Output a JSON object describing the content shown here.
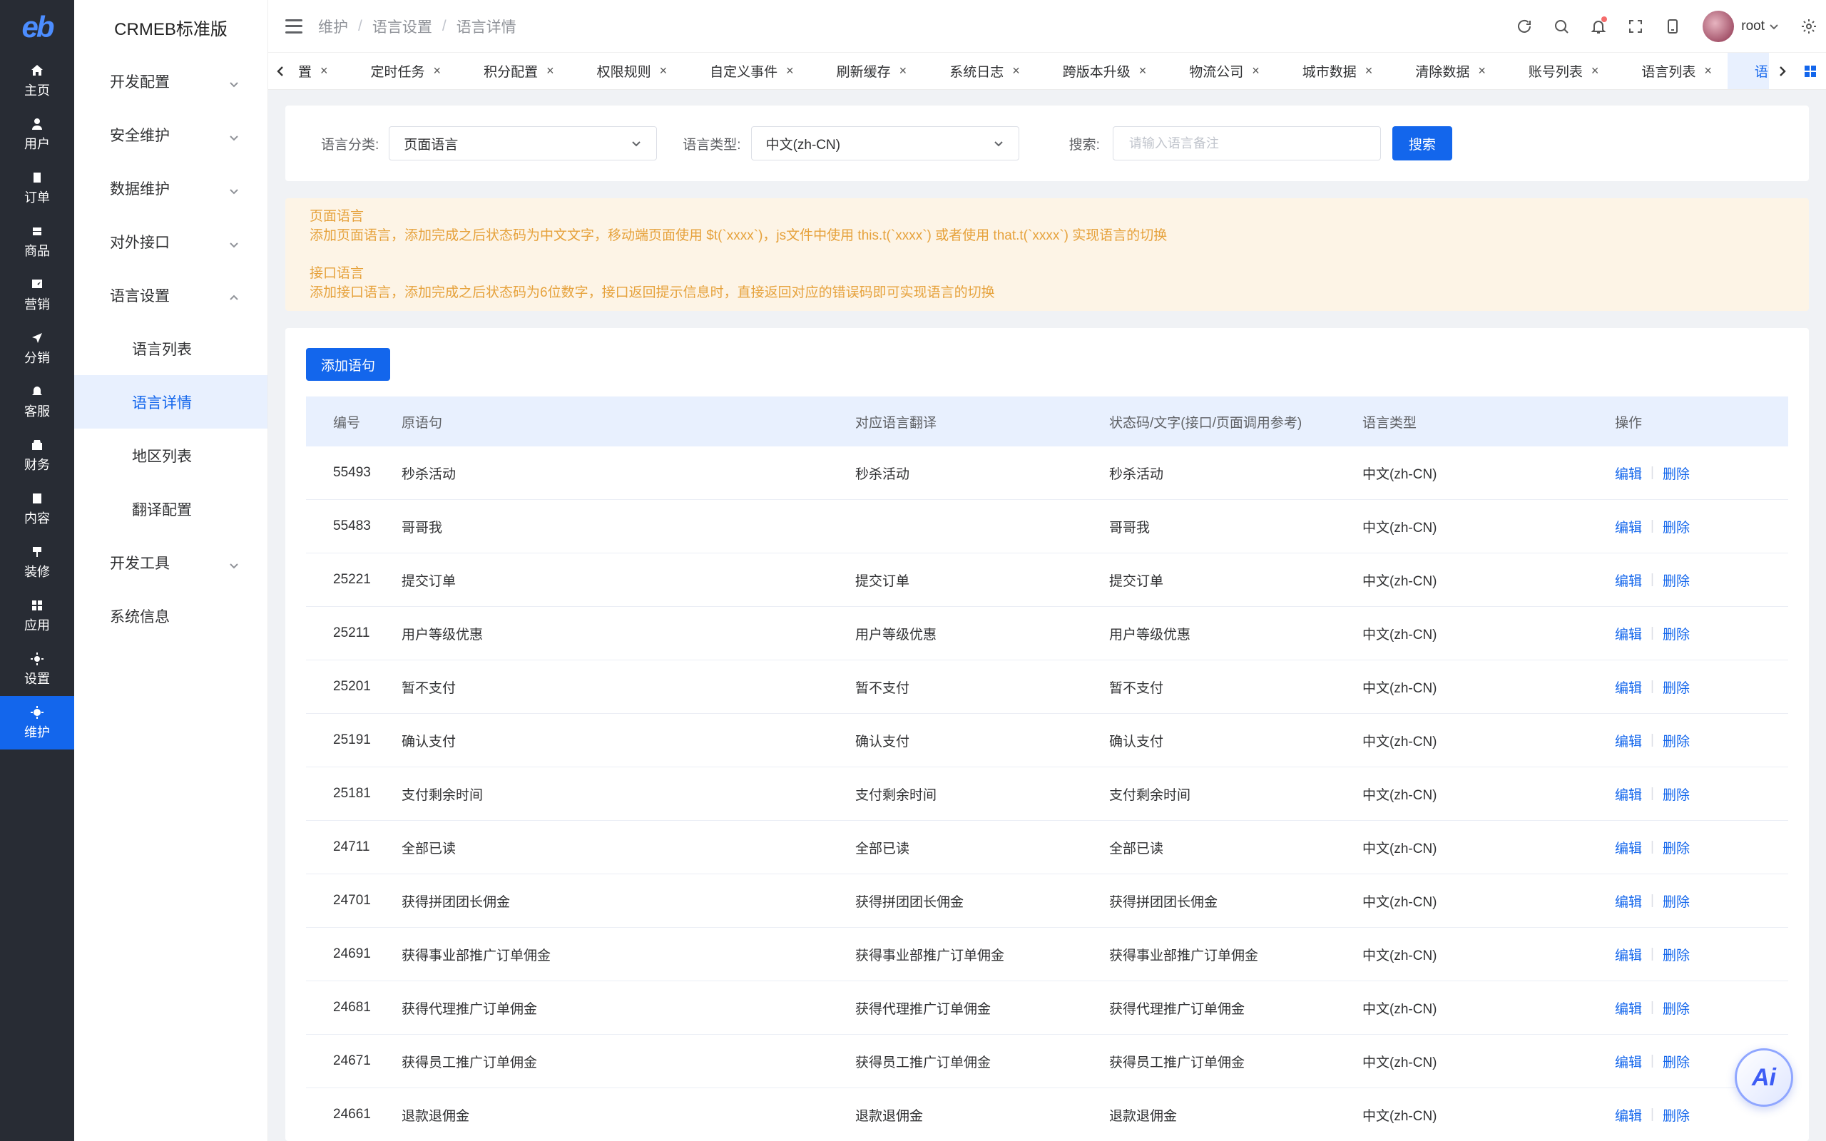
{
  "logo": "eb",
  "brand": "CRMEB标准版",
  "rail": [
    {
      "label": "主页",
      "icon": "home-icon"
    },
    {
      "label": "用户",
      "icon": "user-icon"
    },
    {
      "label": "订单",
      "icon": "order-icon"
    },
    {
      "label": "商品",
      "icon": "product-icon"
    },
    {
      "label": "营销",
      "icon": "marketing-icon"
    },
    {
      "label": "分销",
      "icon": "distribution-icon"
    },
    {
      "label": "客服",
      "icon": "service-icon"
    },
    {
      "label": "财务",
      "icon": "finance-icon"
    },
    {
      "label": "内容",
      "icon": "content-icon"
    },
    {
      "label": "装修",
      "icon": "decorate-icon"
    },
    {
      "label": "应用",
      "icon": "apps-icon"
    },
    {
      "label": "设置",
      "icon": "settings-icon"
    },
    {
      "label": "维护",
      "icon": "maintain-icon",
      "active": true
    }
  ],
  "submenu": {
    "items": [
      "开发配置",
      "安全维护",
      "数据维护",
      "对外接口",
      "语言设置"
    ],
    "lang_children": [
      "语言列表",
      "语言详情",
      "地区列表",
      "翻译配置"
    ],
    "after": [
      "开发工具",
      "系统信息"
    ]
  },
  "breadcrumb": [
    "维护",
    "语言设置",
    "语言详情"
  ],
  "user": {
    "name": "root"
  },
  "tabs": [
    "置",
    "定时任务",
    "积分配置",
    "权限规则",
    "自定义事件",
    "刷新缓存",
    "系统日志",
    "跨版本升级",
    "物流公司",
    "城市数据",
    "清除数据",
    "账号列表",
    "语言列表",
    "语言详情"
  ],
  "active_tab": "语言详情",
  "filter": {
    "category_label": "语言分类:",
    "category_value": "页面语言",
    "type_label": "语言类型:",
    "type_value": "中文(zh-CN)",
    "search_label": "搜索:",
    "search_placeholder": "请输入语言备注",
    "search_button": "搜索"
  },
  "notice": {
    "title1": "页面语言",
    "text1": "添加页面语言，添加完成之后状态码为中文文字，移动端页面使用 $t(`xxxx`)，js文件中使用 this.t(`xxxx`) 或者使用 that.t(`xxxx`) 实现语言的切换",
    "title2": "接口语言",
    "text2": "添加接口语言，添加完成之后状态码为6位数字，接口返回提示信息时，直接返回对应的错误码即可实现语言的切换"
  },
  "add_button": "添加语句",
  "table": {
    "headers": [
      "编号",
      "原语句",
      "对应语言翻译",
      "状态码/文字(接口/页面调用参考)",
      "语言类型",
      "操作"
    ],
    "edit_label": "编辑",
    "delete_label": "删除",
    "rows": [
      {
        "id": "55493",
        "source": "秒杀活动",
        "translation": "秒杀活动",
        "code": "秒杀活动",
        "type": "中文(zh-CN)"
      },
      {
        "id": "55483",
        "source": "哥哥我",
        "translation": "",
        "code": "哥哥我",
        "type": "中文(zh-CN)"
      },
      {
        "id": "25221",
        "source": "提交订单",
        "translation": "提交订单",
        "code": "提交订单",
        "type": "中文(zh-CN)"
      },
      {
        "id": "25211",
        "source": "用户等级优惠",
        "translation": "用户等级优惠",
        "code": "用户等级优惠",
        "type": "中文(zh-CN)"
      },
      {
        "id": "25201",
        "source": "暂不支付",
        "translation": "暂不支付",
        "code": "暂不支付",
        "type": "中文(zh-CN)"
      },
      {
        "id": "25191",
        "source": "确认支付",
        "translation": "确认支付",
        "code": "确认支付",
        "type": "中文(zh-CN)"
      },
      {
        "id": "25181",
        "source": "支付剩余时间",
        "translation": "支付剩余时间",
        "code": "支付剩余时间",
        "type": "中文(zh-CN)"
      },
      {
        "id": "24711",
        "source": "全部已读",
        "translation": "全部已读",
        "code": "全部已读",
        "type": "中文(zh-CN)"
      },
      {
        "id": "24701",
        "source": "获得拼团团长佣金",
        "translation": "获得拼团团长佣金",
        "code": "获得拼团团长佣金",
        "type": "中文(zh-CN)"
      },
      {
        "id": "24691",
        "source": "获得事业部推广订单佣金",
        "translation": "获得事业部推广订单佣金",
        "code": "获得事业部推广订单佣金",
        "type": "中文(zh-CN)"
      },
      {
        "id": "24681",
        "source": "获得代理推广订单佣金",
        "translation": "获得代理推广订单佣金",
        "code": "获得代理推广订单佣金",
        "type": "中文(zh-CN)"
      },
      {
        "id": "24671",
        "source": "获得员工推广订单佣金",
        "translation": "获得员工推广订单佣金",
        "code": "获得员工推广订单佣金",
        "type": "中文(zh-CN)"
      },
      {
        "id": "24661",
        "source": "退款退佣金",
        "translation": "退款退佣金",
        "code": "退款退佣金",
        "type": "中文(zh-CN)"
      }
    ]
  },
  "ai_button": "Ai",
  "colors": {
    "primary": "#1366ec",
    "rail": "#282c34",
    "notice_bg": "#fdf4e6",
    "notice_text": "#e6a23c"
  }
}
